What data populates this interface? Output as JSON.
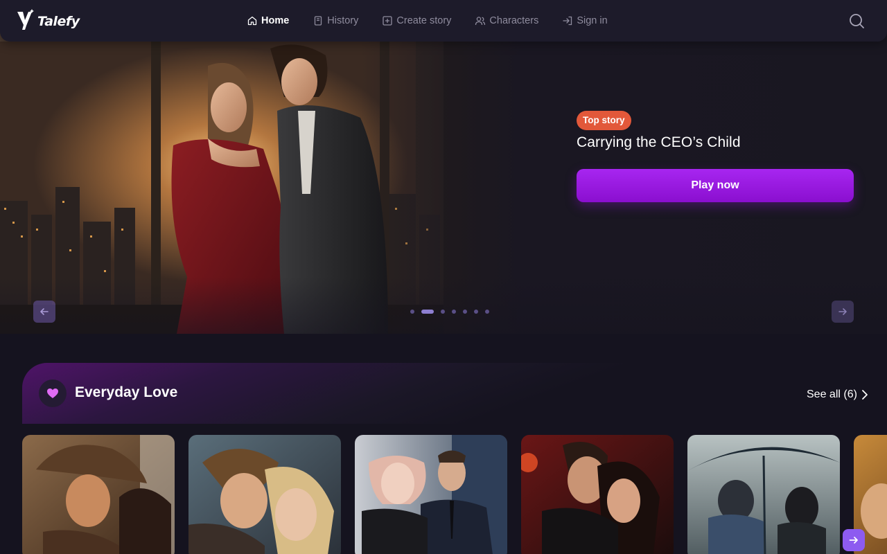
{
  "header": {
    "logo_text": "Talefy",
    "nav": [
      {
        "label": "Home",
        "icon": "home-icon",
        "active": true
      },
      {
        "label": "History",
        "icon": "book-icon",
        "active": false
      },
      {
        "label": "Create story",
        "icon": "plus-square-icon",
        "active": false
      },
      {
        "label": "Characters",
        "icon": "users-icon",
        "active": false
      },
      {
        "label": "Sign in",
        "icon": "sign-in-icon",
        "active": false
      }
    ],
    "search_icon": "search-icon"
  },
  "hero": {
    "badge": "Top story",
    "title": "Carrying the CEO’s Child",
    "play_label": "Play now",
    "slide_count": 7,
    "active_slide": 2,
    "badge_color": "#e2583a",
    "play_color": "#9b1ce0"
  },
  "section": {
    "title": "Everyday Love",
    "icon": "heart-icon",
    "see_all_label": "See all (6)",
    "accent_color": "#e06cf5"
  },
  "cards": [
    {
      "name": "cowboy-romance"
    },
    {
      "name": "forehead-kiss"
    },
    {
      "name": "city-couple"
    },
    {
      "name": "dark-embrace"
    },
    {
      "name": "umbrella-rain"
    },
    {
      "name": "partial-card"
    }
  ]
}
